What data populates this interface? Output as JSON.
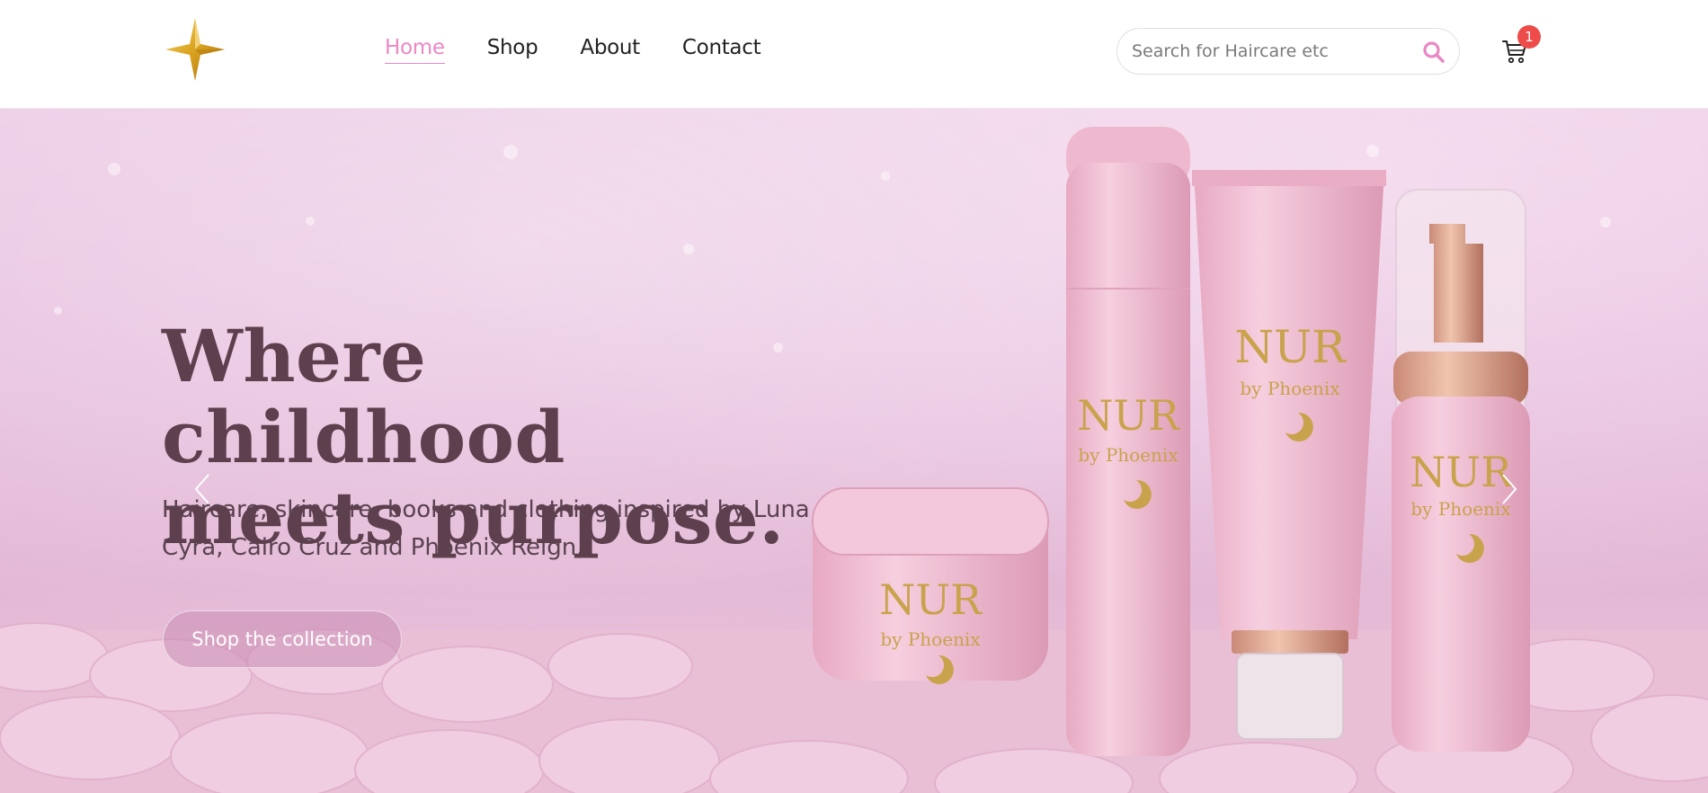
{
  "header": {
    "nav": [
      {
        "label": "Home",
        "active": true
      },
      {
        "label": "Shop",
        "active": false
      },
      {
        "label": "About",
        "active": false
      },
      {
        "label": "Contact",
        "active": false
      }
    ],
    "search": {
      "placeholder": "Search for Haircare etc"
    },
    "cart": {
      "count": "1"
    }
  },
  "hero": {
    "title_line1": "Where childhood",
    "title_line2": "meets purpose.",
    "subtitle_line1": "Haircare, skincare, books and clothing inspired by Luna",
    "subtitle_line2": "Cyra, Cairo Cruz and Phoenix Reign.",
    "cta_label": "Shop the collection",
    "product_brand": "NUR",
    "product_sub": "by Phoenix"
  },
  "colors": {
    "accent_pink": "#ea88c4",
    "badge_red": "#ee4b4b",
    "hero_text": "#5e3f4d",
    "logo_gold": "#d9a21e"
  },
  "icons": {
    "logo": "four-point-star-icon",
    "search": "search-icon",
    "cart": "cart-icon",
    "prev": "chevron-left-icon",
    "next": "chevron-right-icon"
  }
}
